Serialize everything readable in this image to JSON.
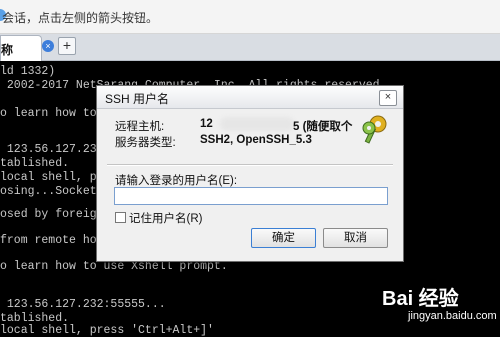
{
  "hint_bar": {
    "text": "会话，点击左侧的箭头按钮。"
  },
  "tabs": [
    {
      "label": "称"
    }
  ],
  "tab_close_glyph": "×",
  "new_tab_glyph": "+",
  "terminal": {
    "lines": [
      "ld 1332)",
      " 2002-2017 NetSarang Computer, Inc. All rights reserved.",
      "",
      "o learn how to u",
      "",
      "",
      " 123.56.127.232:",
      "tablished.",
      "local shell, pre",
      "osing...Socket c",
      "",
      "osed by foreign",
      "",
      "from remote host",
      "",
      "o learn how to use Xshell prompt.",
      "",
      "",
      " 123.56.127.232:55555...",
      "tablished.",
      "local shell, press 'Ctrl+Alt+]'"
    ]
  },
  "dialog": {
    "title": "SSH 用户名",
    "close_glyph": "×",
    "host_label": "远程主机:",
    "host_value_prefix": "12",
    "host_value_suffix": "5 (随便取个",
    "type_label": "服务器类型:",
    "type_value": "SSH2, OpenSSH_5.3",
    "username_label": "请输入登录的用户名(E):",
    "username_value": "",
    "remember_label": "记住用户名(R)",
    "ok_label": "确定",
    "cancel_label": "取消"
  },
  "watermark": {
    "main": "Bai 经验",
    "sub": "jingyan.baidu.com"
  }
}
